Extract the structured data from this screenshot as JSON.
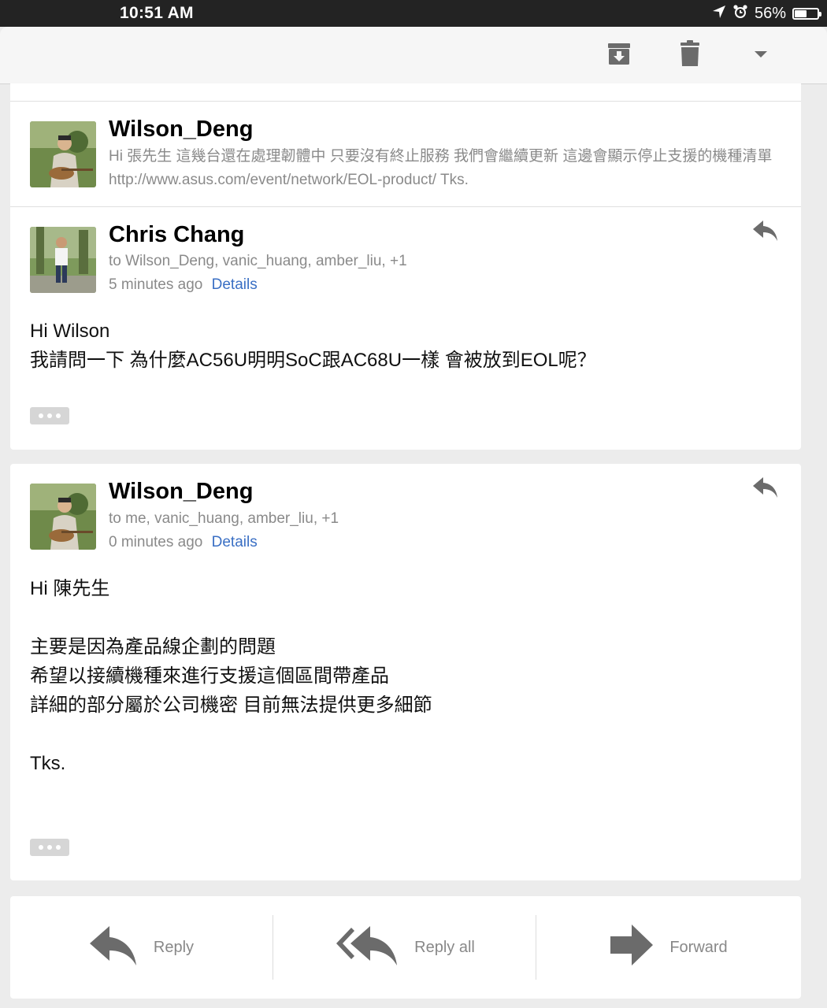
{
  "status_bar": {
    "time": "10:51 AM",
    "battery_percent": "56%",
    "battery_level": 0.56
  },
  "toolbar": {
    "icons": [
      "archive-icon",
      "trash-icon",
      "dropdown-caret-icon"
    ]
  },
  "thread": {
    "collapsed_message": {
      "sender": "Wilson_Deng",
      "snippet": "Hi 張先生 這幾台還在處理韌體中 只要沒有終止服務 我們會繼續更新 這邊會顯示停止支援的機種清單 http://www.asus.com/event/network/EOL-product/ Tks."
    },
    "messages": [
      {
        "sender": "Chris Chang",
        "recipients": "to Wilson_Deng, vanic_huang, amber_liu, +1",
        "time": "5 minutes ago",
        "details_link": "Details",
        "body": "Hi Wilson\n我請問一下 為什麼AC56U明明SoC跟AC68U一樣 會被放到EOL呢？"
      },
      {
        "sender": "Wilson_Deng",
        "recipients": "to me, vanic_huang, amber_liu, +1",
        "time": "0 minutes ago",
        "details_link": "Details",
        "body": "Hi 陳先生\n\n主要是因為產品線企劃的問題\n希望以接續機種來進行支援這個區間帶產品\n詳細的部分屬於公司機密 目前無法提供更多細節\n\nTks."
      }
    ]
  },
  "actions": {
    "reply": "Reply",
    "reply_all": "Reply all",
    "forward": "Forward"
  },
  "colors": {
    "link": "#3a6fc4",
    "secondary_text": "#8a8a8a",
    "icon_gray": "#6b6b6b"
  }
}
